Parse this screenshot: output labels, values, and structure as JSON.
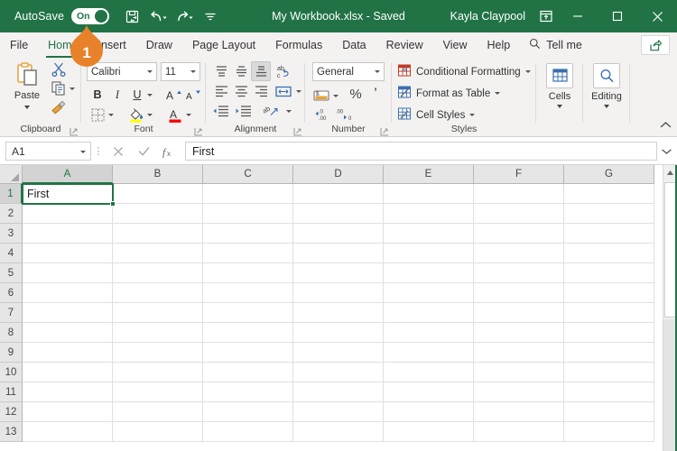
{
  "titlebar": {
    "autosave_label": "AutoSave",
    "autosave_state": "On",
    "save_icon": "save-icon",
    "undo_icon": "undo-icon",
    "redo_icon": "redo-icon",
    "more_icon": "qat-more-icon",
    "document_title": "My Workbook.xlsx - Saved",
    "account_name": "Kayla Claypool",
    "ribbon_display_icon": "ribbon-display-options-icon",
    "minimize_icon": "minimize-icon",
    "maximize_icon": "maximize-icon",
    "close_icon": "close-icon",
    "bg_color": "#217346"
  },
  "tabs": [
    {
      "label": "File",
      "active": false
    },
    {
      "label": "Home",
      "active": true
    },
    {
      "label": "Insert",
      "active": false
    },
    {
      "label": "Draw",
      "active": false
    },
    {
      "label": "Page Layout",
      "active": false
    },
    {
      "label": "Formulas",
      "active": false
    },
    {
      "label": "Data",
      "active": false
    },
    {
      "label": "Review",
      "active": false
    },
    {
      "label": "View",
      "active": false
    },
    {
      "label": "Help",
      "active": false
    }
  ],
  "tellme": {
    "label": "Tell me",
    "icon": "search-icon"
  },
  "share": {
    "icon": "share-icon"
  },
  "ribbon": {
    "clipboard": {
      "title": "Clipboard",
      "paste_label": "Paste",
      "cut_label": "Cut",
      "copy_label": "Copy",
      "format_painter_label": "Format Painter",
      "launcher": "clipboard-dialog-launcher"
    },
    "font": {
      "title": "Font",
      "font_name": "Calibri",
      "font_size": "11",
      "bold_label": "B",
      "italic_label": "I",
      "underline_label": "U",
      "grow_font_label": "A",
      "shrink_font_label": "A",
      "borders_label": "Borders",
      "fill_color_label": "Fill Color",
      "fill_color": "#ffff00",
      "font_color_label": "Font Color",
      "font_color": "#ff0000",
      "launcher": "font-dialog-launcher"
    },
    "alignment": {
      "title": "Alignment",
      "top_align_label": "Top Align",
      "middle_align_label": "Middle Align",
      "bottom_align_label": "Bottom Align",
      "wrap_text_label": "Wrap Text",
      "align_left_label": "Align Left",
      "center_label": "Center",
      "align_right_label": "Align Right",
      "merge_label": "Merge & Center",
      "decrease_indent_label": "Decrease Indent",
      "increase_indent_label": "Increase Indent",
      "orientation_label": "Orientation",
      "launcher": "alignment-dialog-launcher"
    },
    "number": {
      "title": "Number",
      "format": "General",
      "accounting_label": "Accounting Number Format",
      "percent_label": "%",
      "comma_label": "Comma Style",
      "increase_decimal_label": "Increase Decimal",
      "decrease_decimal_label": "Decrease Decimal",
      "launcher": "number-dialog-launcher"
    },
    "styles": {
      "title": "Styles",
      "items": [
        {
          "label": "Conditional Formatting",
          "icon": "conditional-formatting-icon"
        },
        {
          "label": "Format as Table",
          "icon": "format-as-table-icon"
        },
        {
          "label": "Cell Styles",
          "icon": "cell-styles-icon"
        }
      ]
    },
    "cells": {
      "label": "Cells",
      "icon": "cells-icon"
    },
    "editing": {
      "label": "Editing",
      "icon": "editing-icon"
    },
    "collapse_label": "Collapse the Ribbon"
  },
  "formulabar": {
    "name_box_value": "A1",
    "cancel_icon": "cancel-icon",
    "enter_icon": "enter-icon",
    "function_icon": "insert-function-icon",
    "formula_value": "First",
    "expand_icon": "expand-formula-bar-icon"
  },
  "grid": {
    "columns": [
      "A",
      "B",
      "C",
      "D",
      "E",
      "F",
      "G"
    ],
    "rows": [
      "1",
      "2",
      "3",
      "4",
      "5",
      "6",
      "7",
      "8",
      "9",
      "10",
      "11",
      "12",
      "13"
    ],
    "selected_column": "A",
    "selected_row": "1",
    "selected_cell": "A1",
    "cells": [
      {
        "ref": "A1",
        "col": 0,
        "row": 0,
        "value": "First"
      }
    ],
    "selection_color": "#217346"
  },
  "callout": {
    "number": "1",
    "color": "#e8822a"
  },
  "scrollbar": {
    "up_icon": "scroll-up-icon"
  }
}
